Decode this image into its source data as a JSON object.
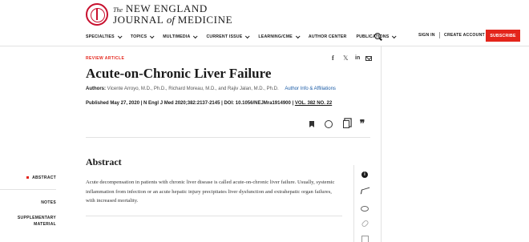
{
  "logo": {
    "the": "The",
    "line1": "NEW ENGLAND",
    "line2_a": "JOURNAL",
    "line2_of": "of",
    "line2_b": "MEDICINE"
  },
  "nav": [
    {
      "label": "SPECIALTIES",
      "dropdown": true
    },
    {
      "label": "TOPICS",
      "dropdown": true
    },
    {
      "label": "MULTIMEDIA",
      "dropdown": true
    },
    {
      "label": "CURRENT ISSUE",
      "dropdown": true
    },
    {
      "label": "LEARNING/CME",
      "dropdown": true
    },
    {
      "label": "AUTHOR CENTER",
      "dropdown": false
    },
    {
      "label": "PUBLICATIONS",
      "dropdown": true
    }
  ],
  "auth": {
    "signin": "SIGN IN",
    "create": "CREATE ACCOUNT",
    "subscribe": "SUBSCRIBE"
  },
  "article": {
    "type_label": "REVIEW ARTICLE",
    "title": "Acute-on-Chronic Liver Failure",
    "authors_label": "Authors:",
    "authors": "Vicente Arroyo, M.D., Ph.D., Richard Moreau, M.D., and Rajiv Jalan, M.D., Ph.D.",
    "affiliations_link": "Author Info & Affiliations",
    "published": "Published May 27, 2020 | N Engl J Med 2020;382:2137-2145 | DOI: 10.1056/NEJMra1914900 | ",
    "volume": "VOL. 382 NO. 22"
  },
  "abstract": {
    "heading": "Abstract",
    "body": "Acute decompensation in patients with chronic liver disease is called acute-on-chronic liver failure. Usually, systemic inflammation from infection or an acute hepatic injury precipitates liver dysfunction and extrahepatic organ failures, with increased mortality."
  },
  "toc": {
    "abstract": "ABSTRACT",
    "notes": "NOTES",
    "supp_1": "SUPPLEMENTARY",
    "supp_2": "MATERIAL"
  },
  "colors": {
    "brand_red": "#e4251b",
    "link_blue": "#1a5ba6"
  }
}
